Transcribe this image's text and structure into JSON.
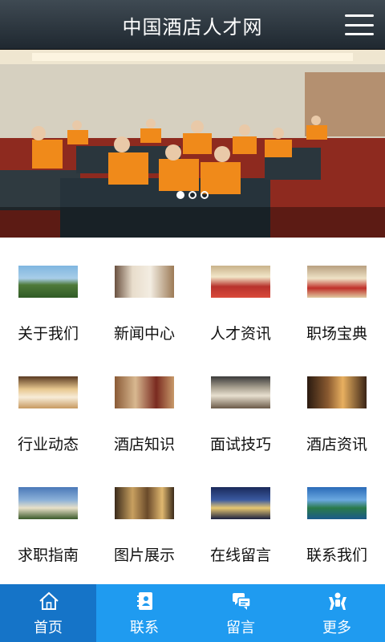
{
  "header": {
    "title": "中国酒店人才网",
    "menu_icon": "menu-icon"
  },
  "banner": {
    "slides": 3,
    "active_slide": 1
  },
  "grid": [
    {
      "label": "关于我们",
      "thumb": "resort"
    },
    {
      "label": "新闻中心",
      "thumb": "bedroom"
    },
    {
      "label": "人才资讯",
      "thumb": "banquet"
    },
    {
      "label": "职场宝典",
      "thumb": "hall"
    },
    {
      "label": "行业动态",
      "thumb": "dining"
    },
    {
      "label": "酒店知识",
      "thumb": "room"
    },
    {
      "label": "面试技巧",
      "thumb": "restaurant"
    },
    {
      "label": "酒店资讯",
      "thumb": "lobby"
    },
    {
      "label": "求职指南",
      "thumb": "exterior"
    },
    {
      "label": "图片展示",
      "thumb": "corridor"
    },
    {
      "label": "在线留言",
      "thumb": "night-tower"
    },
    {
      "label": "联系我们",
      "thumb": "coast"
    }
  ],
  "tabbar": {
    "items": [
      {
        "label": "首页",
        "icon": "home-icon"
      },
      {
        "label": "联系",
        "icon": "contacts-icon"
      },
      {
        "label": "留言",
        "icon": "message-icon"
      },
      {
        "label": "更多",
        "icon": "more-icon"
      }
    ],
    "active": 0
  }
}
